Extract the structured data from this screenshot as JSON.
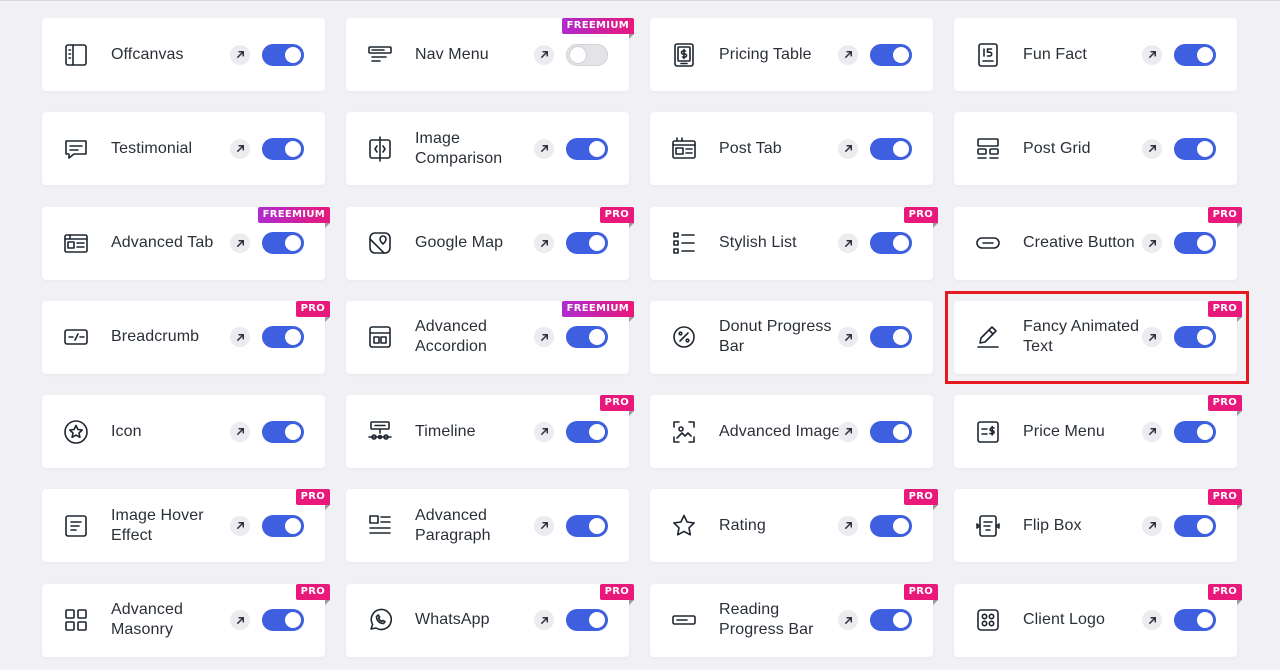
{
  "colors": {
    "toggle_on": "#3d5fe0",
    "pro_badge": "#e8197a",
    "freemium_badge": "#b02ad0",
    "highlight": "#e5191f"
  },
  "widgets": [
    {
      "name": "Offcanvas",
      "icon": "offcanvas-icon",
      "badge": "",
      "enabled": true
    },
    {
      "name": "Nav Menu",
      "icon": "nav-menu-icon",
      "badge": "FREEMIUM",
      "enabled": false
    },
    {
      "name": "Pricing Table",
      "icon": "pricing-table-icon",
      "badge": "",
      "enabled": true
    },
    {
      "name": "Fun Fact",
      "icon": "fun-fact-icon",
      "badge": "",
      "enabled": true
    },
    {
      "name": "Testimonial",
      "icon": "testimonial-icon",
      "badge": "",
      "enabled": true
    },
    {
      "name": "Image Comparison",
      "icon": "image-comparison-icon",
      "badge": "",
      "enabled": true
    },
    {
      "name": "Post Tab",
      "icon": "post-tab-icon",
      "badge": "",
      "enabled": true
    },
    {
      "name": "Post Grid",
      "icon": "post-grid-icon",
      "badge": "",
      "enabled": true
    },
    {
      "name": "Advanced Tab",
      "icon": "advanced-tab-icon",
      "badge": "FREEMIUM",
      "enabled": true
    },
    {
      "name": "Google Map",
      "icon": "google-map-icon",
      "badge": "PRO",
      "enabled": true
    },
    {
      "name": "Stylish List",
      "icon": "stylish-list-icon",
      "badge": "PRO",
      "enabled": true
    },
    {
      "name": "Creative Button",
      "icon": "creative-button-icon",
      "badge": "PRO",
      "enabled": true
    },
    {
      "name": "Breadcrumb",
      "icon": "breadcrumb-icon",
      "badge": "PRO",
      "enabled": true
    },
    {
      "name": "Advanced Accordion",
      "icon": "advanced-accordion-icon",
      "badge": "FREEMIUM",
      "enabled": true
    },
    {
      "name": "Donut Progress Bar",
      "icon": "donut-progress-bar-icon",
      "badge": "",
      "enabled": true
    },
    {
      "name": "Fancy Animated Text",
      "icon": "fancy-animated-text-icon",
      "badge": "PRO",
      "enabled": true,
      "highlighted": true
    },
    {
      "name": "Icon",
      "icon": "star-circle-icon",
      "badge": "",
      "enabled": true
    },
    {
      "name": "Timeline",
      "icon": "timeline-icon",
      "badge": "PRO",
      "enabled": true
    },
    {
      "name": "Advanced Image",
      "icon": "advanced-image-icon",
      "badge": "",
      "enabled": true
    },
    {
      "name": "Price Menu",
      "icon": "price-menu-icon",
      "badge": "PRO",
      "enabled": true
    },
    {
      "name": "Image Hover Effect",
      "icon": "image-hover-effect-icon",
      "badge": "PRO",
      "enabled": true
    },
    {
      "name": "Advanced Paragraph",
      "icon": "advanced-paragraph-icon",
      "badge": "",
      "enabled": true
    },
    {
      "name": "Rating",
      "icon": "rating-star-icon",
      "badge": "PRO",
      "enabled": true
    },
    {
      "name": "Flip Box",
      "icon": "flip-box-icon",
      "badge": "PRO",
      "enabled": true
    },
    {
      "name": "Advanced Masonry",
      "icon": "advanced-masonry-icon",
      "badge": "PRO",
      "enabled": true
    },
    {
      "name": "WhatsApp",
      "icon": "whatsapp-icon",
      "badge": "PRO",
      "enabled": true
    },
    {
      "name": "Reading Progress Bar",
      "icon": "reading-progress-bar-icon",
      "badge": "PRO",
      "enabled": true
    },
    {
      "name": "Client Logo",
      "icon": "client-logo-icon",
      "badge": "PRO",
      "enabled": true
    }
  ]
}
